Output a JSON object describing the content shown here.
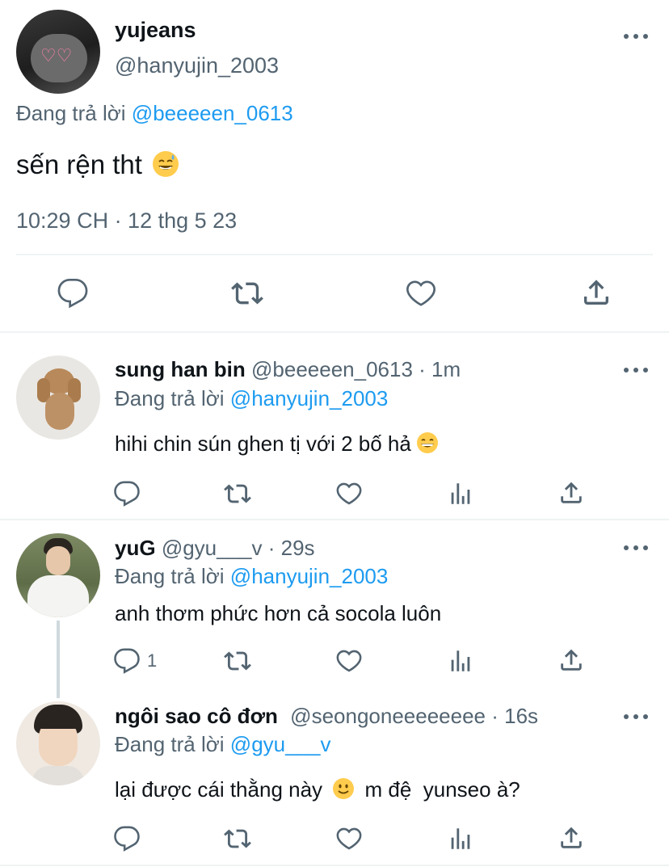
{
  "main_tweet": {
    "display_name": "yujeans",
    "handle": "@hanyujin_2003",
    "replying_prefix": "Đang trả lời",
    "replying_to": "@beeeeen_0613",
    "text": "sến rện tht",
    "emoji": "sweat-smile-emoji",
    "timestamp": "10:29 CH · 12 thg 5 23",
    "actions": [
      "reply-icon",
      "retweet-icon",
      "like-icon",
      "share-icon"
    ]
  },
  "replies": [
    {
      "display_name": "sung han bin",
      "handle": "@beeeeen_0613",
      "time": "· 1m",
      "replying_prefix": "Đang trả lời",
      "replying_to": "@hanyujin_2003",
      "text": "hihi chin sún ghen tị với 2 bố hả",
      "emoji": "grin-emoji",
      "reply_count": ""
    },
    {
      "display_name": "yuG",
      "handle": "@gyu___v",
      "time": "· 29s",
      "replying_prefix": "Đang trả lời",
      "replying_to": "@hanyujin_2003",
      "text": "anh thơm phức hơn cả socola luôn",
      "reply_count": "1"
    },
    {
      "display_name": "ngôi sao cô đơn",
      "handle": "@seongoneeeeeeee",
      "time": "· 16s",
      "replying_prefix": "Đang trả lời",
      "replying_to": "@gyu___v",
      "text_before": "lại được cái thằng này",
      "emoji": "slight-smile-emoji",
      "text_after": "m đệ  yunseo à?",
      "reply_count": ""
    }
  ],
  "colors": {
    "link": "#1d9bf0",
    "secondary_text": "#536471",
    "primary_text": "#0f1419",
    "divider": "#eff3f4"
  }
}
